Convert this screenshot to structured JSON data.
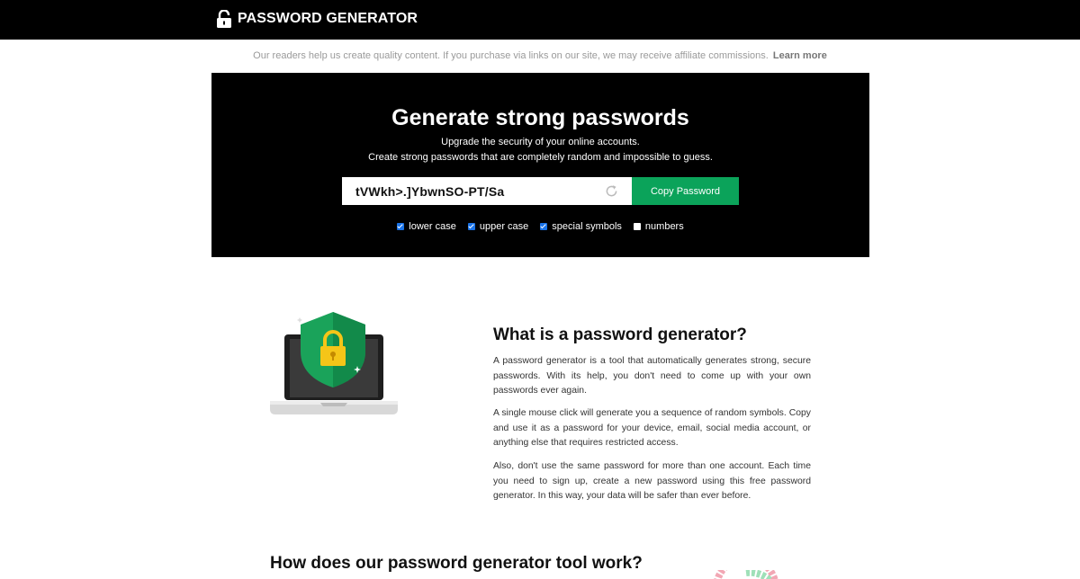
{
  "header": {
    "brand": "PASSWORD GENERATOR",
    "brand_icon": "unlocked-lock-icon"
  },
  "affiliate": {
    "text": "Our readers help us create quality content. If you purchase via links on our site, we may receive affiliate commissions.",
    "link": "Learn more"
  },
  "hero": {
    "title": "Generate strong passwords",
    "subtitle_line1": "Upgrade the security of your online accounts.",
    "subtitle_line2": "Create strong passwords that are completely random and impossible to guess.",
    "password": "tVWkh>.]YbwnSO-PT/Sa",
    "copy_button": "Copy Password",
    "options": [
      {
        "label": "lower case",
        "checked": true
      },
      {
        "label": "upper case",
        "checked": true
      },
      {
        "label": "special symbols",
        "checked": true
      },
      {
        "label": "numbers",
        "checked": false
      }
    ]
  },
  "article": {
    "heading": "What is a password generator?",
    "paragraphs": [
      "A password generator is a tool that automatically generates strong, secure passwords. With its help, you don't need to come up with your own passwords ever again.",
      "A single mouse click will generate you a sequence of random symbols. Copy and use it as a password for your device, email, social media account, or anything else that requires restricted access.",
      "Also, don't use the same password for more than one account. Each time you need to sign up, create a new password using this free password generator. In this way, your data will be safer than ever before."
    ],
    "how_heading": "How does our password generator tool work?"
  },
  "colors": {
    "accent_green": "#0ba35a",
    "checkbox_blue": "#1a73e8",
    "shield_green": "#1aa35a",
    "lock_yellow": "#f5c518"
  }
}
